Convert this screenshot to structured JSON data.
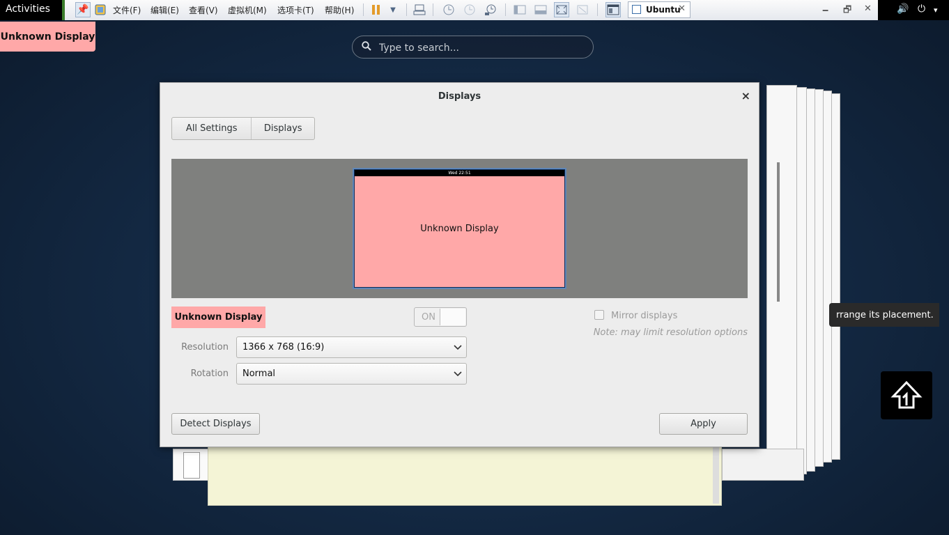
{
  "topbar": {
    "activities_label": "Activities",
    "menu": [
      "文件(F)",
      "编辑(E)",
      "查看(V)",
      "虚拟机(M)",
      "选项卡(T)",
      "帮助(H)"
    ],
    "tab_label": "Ubuntu",
    "tab_close": "✕",
    "window_controls": {
      "minimize": "🗕",
      "restore": "🗗",
      "close": "✕"
    },
    "tray": {
      "volume": "🔊",
      "power": "⏻",
      "power_arrow": "▾"
    }
  },
  "overview": {
    "display_badge": "Unknown Display",
    "search_placeholder": "Type to search...",
    "tooltip": "rrange its placement."
  },
  "dialog": {
    "title": "Displays",
    "close_glyph": "×",
    "breadcrumb": {
      "all_settings": "All Settings",
      "displays": "Displays"
    },
    "preview": {
      "topbar_time": "Wed 22:51",
      "monitor_label": "Unknown Display"
    },
    "display_name": "Unknown Display",
    "toggle_label": "ON",
    "resolution": {
      "label": "Resolution",
      "value": "1366 x 768 (16:9)"
    },
    "rotation": {
      "label": "Rotation",
      "value": "Normal"
    },
    "mirror": {
      "label": "Mirror displays",
      "note": "Note: may limit resolution options",
      "checked": false
    },
    "detect_button": "Detect Displays",
    "apply_button": "Apply"
  },
  "colors": {
    "display_highlight": "#ffa8a8",
    "preview_bg": "#7f807e",
    "dialog_bg": "#ededed"
  }
}
